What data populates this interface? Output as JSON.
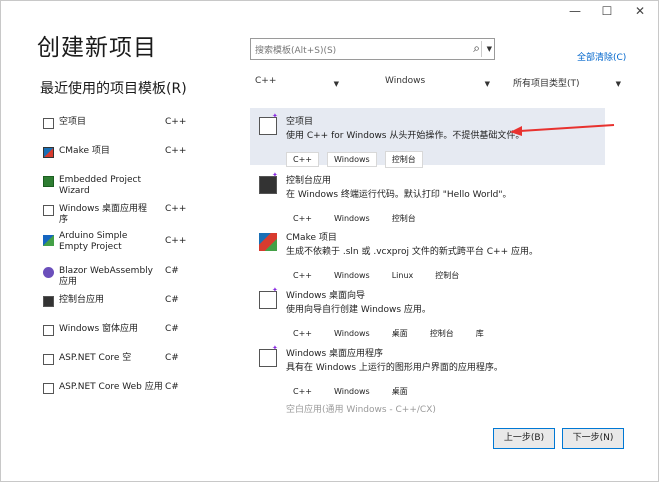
{
  "window": {
    "minimize": "—",
    "maximize": "☐",
    "close": "✕"
  },
  "title": "创建新项目",
  "recent": {
    "heading": "最近使用的项目模板(R)",
    "items": [
      {
        "label": "空项目",
        "lang": "C++"
      },
      {
        "label": "CMake 项目",
        "lang": "C++"
      },
      {
        "label": "Embedded Project Wizard",
        "lang": ""
      },
      {
        "label": "Windows 桌面应用程序",
        "lang": "C++"
      },
      {
        "label": "Arduino Simple Empty Project",
        "lang": "C++"
      },
      {
        "label": "Blazor WebAssembly 应用",
        "lang": "C#"
      },
      {
        "label": "控制台应用",
        "lang": "C#"
      },
      {
        "label": "Windows 窗体应用",
        "lang": "C#"
      },
      {
        "label": "ASP.NET Core 空",
        "lang": "C#"
      },
      {
        "label": "ASP.NET Core Web 应用",
        "lang": "C#"
      }
    ]
  },
  "search": {
    "placeholder": "搜索模板(Alt+S)(S)"
  },
  "clear_all": "全部清除(C)",
  "filters": {
    "language": "C++",
    "platform": "Windows",
    "project_type": "所有项目类型(T)"
  },
  "templates": [
    {
      "name": "空项目",
      "desc": "使用 C++ for Windows 从头开始操作。不提供基础文件。",
      "tags": [
        "C++",
        "Windows",
        "控制台"
      ]
    },
    {
      "name": "控制台应用",
      "desc": "在 Windows 终端运行代码。默认打印 \"Hello World\"。",
      "tags": [
        "C++",
        "Windows",
        "控制台"
      ]
    },
    {
      "name": "CMake 项目",
      "desc": "生成不依赖于 .sln 或 .vcxproj 文件的新式跨平台 C++ 应用。",
      "tags": [
        "C++",
        "Windows",
        "Linux",
        "控制台"
      ]
    },
    {
      "name": "Windows 桌面向导",
      "desc": "使用向导自行创建 Windows 应用。",
      "tags": [
        "C++",
        "Windows",
        "桌面",
        "控制台",
        "库"
      ]
    },
    {
      "name": "Windows 桌面应用程序",
      "desc": "具有在 Windows 上运行的图形用户界面的应用程序。",
      "tags": [
        "C++",
        "Windows",
        "桌面"
      ]
    }
  ],
  "faded_item": "空白应用(通用 Windows - C++/CX)",
  "buttons": {
    "back": "上一步(B)",
    "next": "下一步(N)"
  },
  "colors": {
    "accent": "#0078d4",
    "link": "#0066cc",
    "selected_bg": "#e6eaf2",
    "arrow": "#e8322f",
    "star": "#8a2be2"
  }
}
